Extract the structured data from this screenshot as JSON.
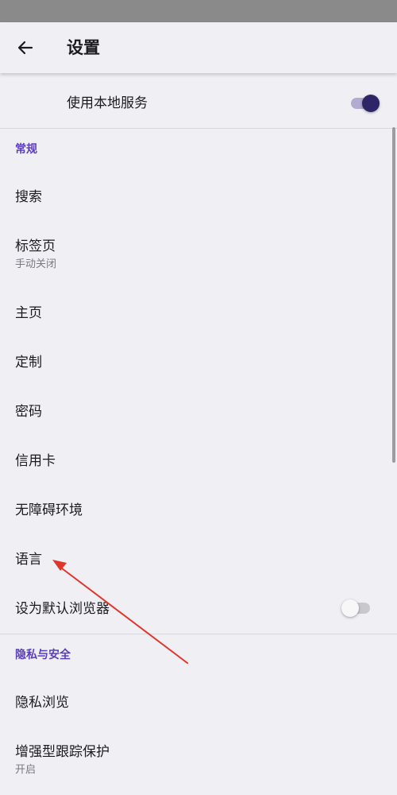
{
  "header": {
    "title": "设置"
  },
  "local_service": {
    "label": "使用本地服务",
    "enabled": true
  },
  "sections": {
    "general": "常规",
    "privacy": "隐私与安全"
  },
  "items": {
    "search": {
      "label": "搜索"
    },
    "tabs": {
      "label": "标签页",
      "sub": "手动关闭"
    },
    "homepage": {
      "label": "主页"
    },
    "customize": {
      "label": "定制"
    },
    "passwords": {
      "label": "密码"
    },
    "credit_cards": {
      "label": "信用卡"
    },
    "accessibility": {
      "label": "无障碍环境"
    },
    "language": {
      "label": "语言"
    },
    "default_browser": {
      "label": "设为默认浏览器",
      "enabled": false
    },
    "private_browsing": {
      "label": "隐私浏览"
    },
    "tracking_protection": {
      "label": "增强型跟踪保护",
      "sub": "开启"
    }
  },
  "colors": {
    "accent": "#5b3fb8",
    "annotation_arrow": "#e0362a"
  },
  "icons": {
    "back": "arrow-left-icon"
  }
}
